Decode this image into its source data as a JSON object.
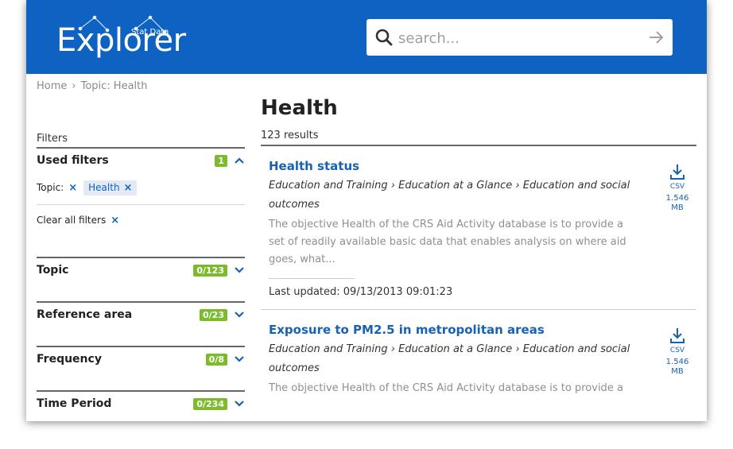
{
  "header": {
    "logo_text": "Explorer",
    "logo_sub": "Stat Data",
    "search_placeholder": "search..."
  },
  "breadcrumb": {
    "home": "Home",
    "sep": "›",
    "current": "Topic: Health"
  },
  "sidebar": {
    "filters_title": "Filters",
    "used_filters": {
      "label": "Used filters",
      "count": "1",
      "topic_label": "Topic:",
      "chip": "Health",
      "clear": "Clear all filters"
    },
    "facets": [
      {
        "label": "Topic",
        "count": "0/123"
      },
      {
        "label": "Reference area",
        "count": "0/23"
      },
      {
        "label": "Frequency",
        "count": "0/8"
      },
      {
        "label": "Time Period",
        "count": "0/234"
      }
    ],
    "x_glyph": "×"
  },
  "main": {
    "title": "Health",
    "results_count": "123 results",
    "results": [
      {
        "title": "Health status",
        "path": "Education and Training › Education at a Glance › Education and social outcomes",
        "desc": "The objective Health of the CRS Aid Activity database is to provide a set of readily available basic data that enables analysis on where aid goes, what...",
        "updated": "Last updated: 09/13/2013 09:01:23",
        "download_type": "CSV",
        "download_size": "1.546 MB"
      },
      {
        "title": "Exposure to PM2.5 in metropolitan areas",
        "path": "Education and Training › Education at a Glance › Education and social outcomes",
        "desc": "The objective Health of the CRS Aid Activity database is to provide a",
        "download_type": "CSV",
        "download_size": "1.546 MB"
      }
    ]
  },
  "colors": {
    "brand": "#0e63c2",
    "badge": "#7dbb2c",
    "link": "#1762b5"
  }
}
